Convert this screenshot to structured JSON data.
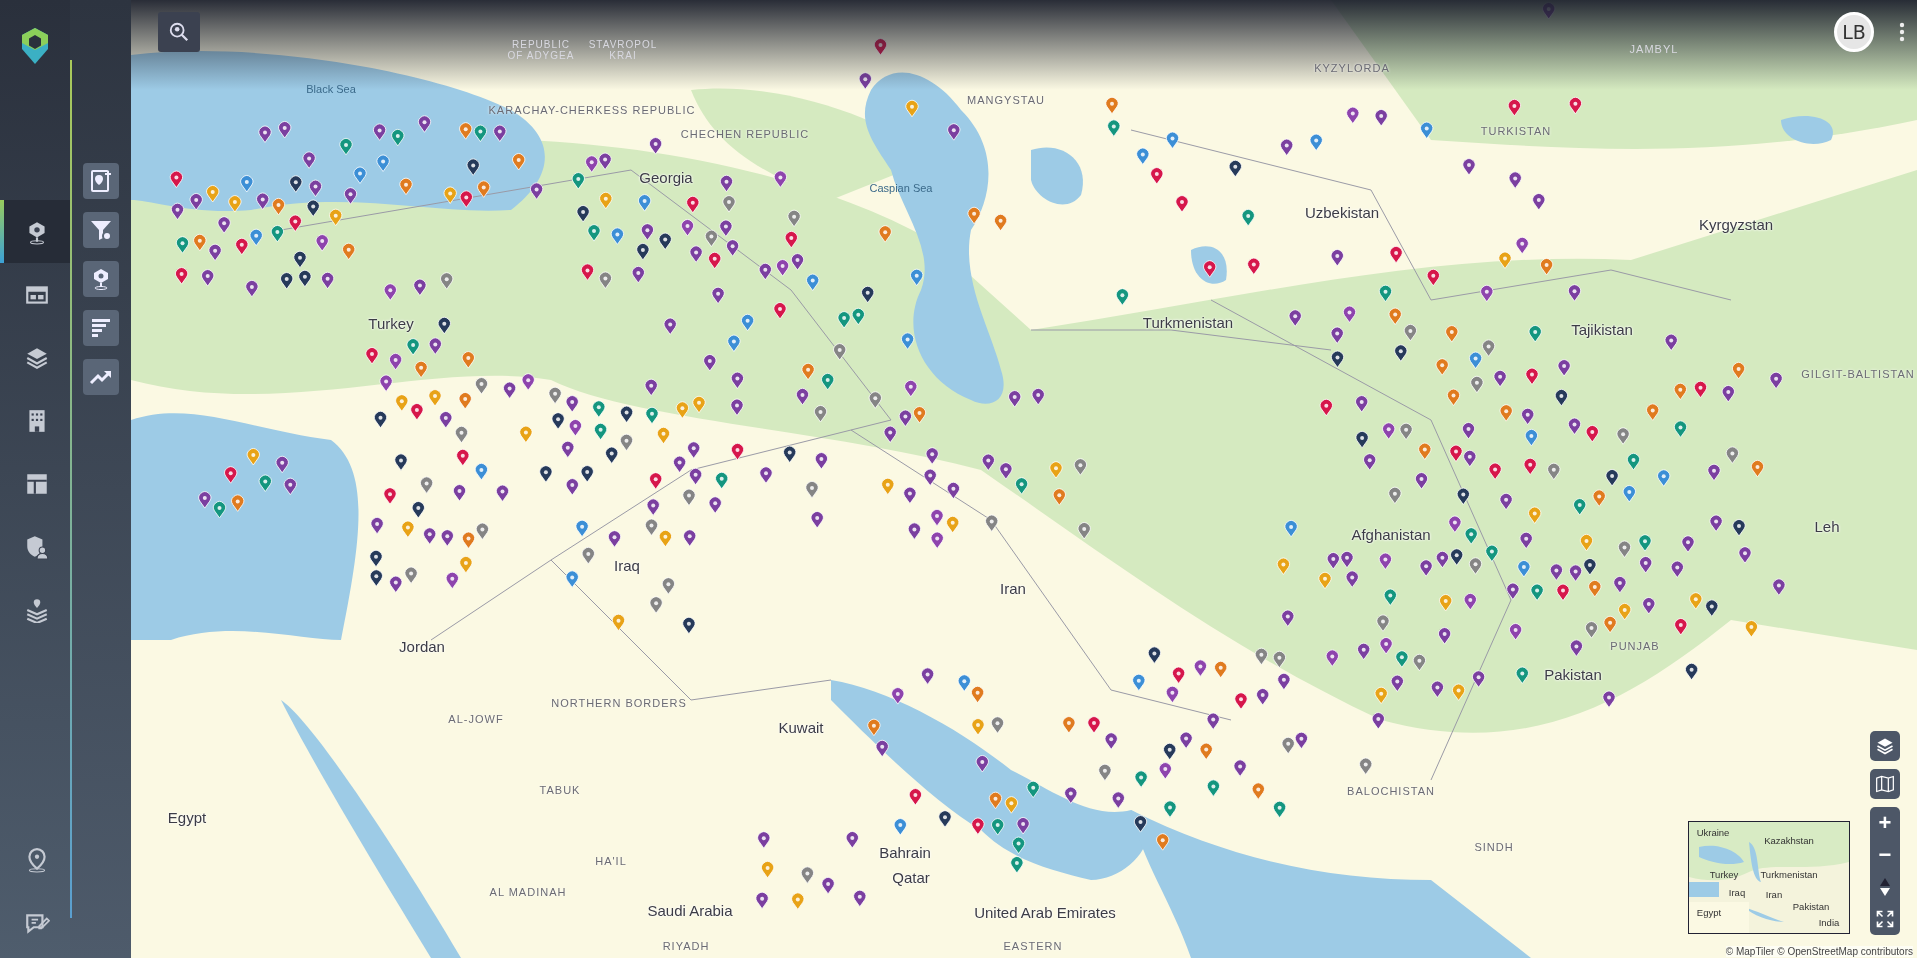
{
  "sidebar": {
    "nav_items": [
      {
        "kind": "map",
        "selected": true
      },
      {
        "kind": "table",
        "selected": false
      },
      {
        "kind": "layers",
        "selected": false
      },
      {
        "kind": "building",
        "selected": false
      },
      {
        "kind": "layout",
        "selected": false
      },
      {
        "kind": "security",
        "selected": false
      },
      {
        "kind": "stack",
        "selected": false
      }
    ],
    "bottom_items": [
      {
        "kind": "location"
      },
      {
        "kind": "feedback"
      }
    ]
  },
  "tool_panel": {
    "tools": [
      {
        "kind": "report"
      },
      {
        "kind": "filter"
      },
      {
        "kind": "pin"
      },
      {
        "kind": "bars"
      },
      {
        "kind": "trend"
      }
    ]
  },
  "user": {
    "initials": "LB"
  },
  "map": {
    "country_labels": [
      "Black Sea",
      "Caspian Sea",
      "Turkey",
      "Georgia",
      "Iraq",
      "Jordan",
      "Egypt",
      "Saudi Arabia",
      "Kuwait",
      "Bahrain",
      "Qatar",
      "United Arab Emirates",
      "Iran",
      "Turkmenistan",
      "Uzbekistan",
      "Kyrgyzstan",
      "Tajikistan",
      "Afghanistan",
      "Pakistan",
      "Leh"
    ],
    "region_labels": [
      "REPUBLIC OF ADYGEA",
      "STAVROPOL KRAI",
      "KARACHAY-CHERKESS REPUBLIC",
      "CHECHEN REPUBLIC",
      "MANGYSTAU",
      "KYZYLORDA",
      "JAMBYL",
      "TURKISTAN",
      "AL-JOWF",
      "NORTHERN BORDERS",
      "TABUK",
      "HA'IL",
      "AL MADINAH",
      "RIYADH",
      "EASTERN",
      "BALOCHISTAN",
      "SINDH",
      "PUNJAB",
      "GILGIT-BALTISTAN"
    ],
    "attribution": "© MapTiler © OpenStreetMap contributors"
  },
  "overview_map": {
    "labels": [
      "Ukraine",
      "Kazakhstan",
      "Turkey",
      "Turkmenistan",
      "Iraq",
      "Iran",
      "Pakistan",
      "Egypt",
      "India"
    ]
  },
  "zoom_controls": {
    "zoom_in": "+",
    "zoom_out": "−"
  }
}
